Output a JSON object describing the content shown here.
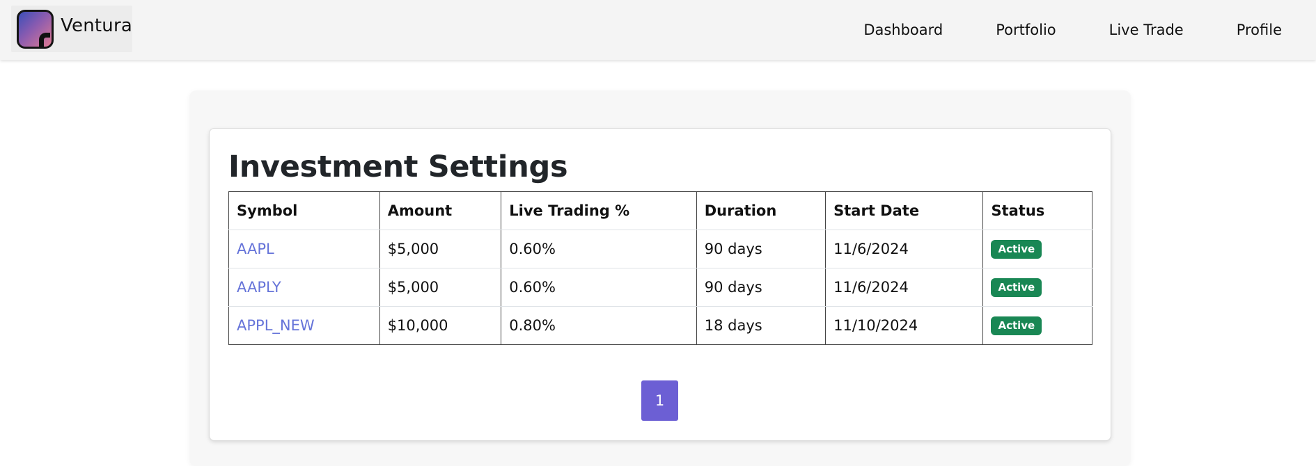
{
  "brand": {
    "name": "Ventura",
    "logo_icon": "ventura-logo-icon"
  },
  "nav": {
    "items": [
      {
        "label": "Dashboard"
      },
      {
        "label": "Portfolio"
      },
      {
        "label": "Live Trade"
      },
      {
        "label": "Profile"
      }
    ]
  },
  "page": {
    "title": "Investment Settings"
  },
  "table": {
    "headers": {
      "symbol": "Symbol",
      "amount": "Amount",
      "live_pct": "Live Trading %",
      "duration": "Duration",
      "start_date": "Start Date",
      "status": "Status"
    },
    "rows": [
      {
        "symbol": "AAPL",
        "amount": "$5,000",
        "live_pct": "0.60%",
        "duration": "90 days",
        "start_date": "11/6/2024",
        "status": "Active"
      },
      {
        "symbol": "AAPLY",
        "amount": "$5,000",
        "live_pct": "0.60%",
        "duration": "90 days",
        "start_date": "11/6/2024",
        "status": "Active"
      },
      {
        "symbol": "APPL_NEW",
        "amount": "$10,000",
        "live_pct": "0.80%",
        "duration": "18 days",
        "start_date": "11/10/2024",
        "status": "Active"
      }
    ]
  },
  "pagination": {
    "current": "1"
  },
  "colors": {
    "accent": "#6c5fd4",
    "status_active": "#198754",
    "link": "#6674d9"
  }
}
